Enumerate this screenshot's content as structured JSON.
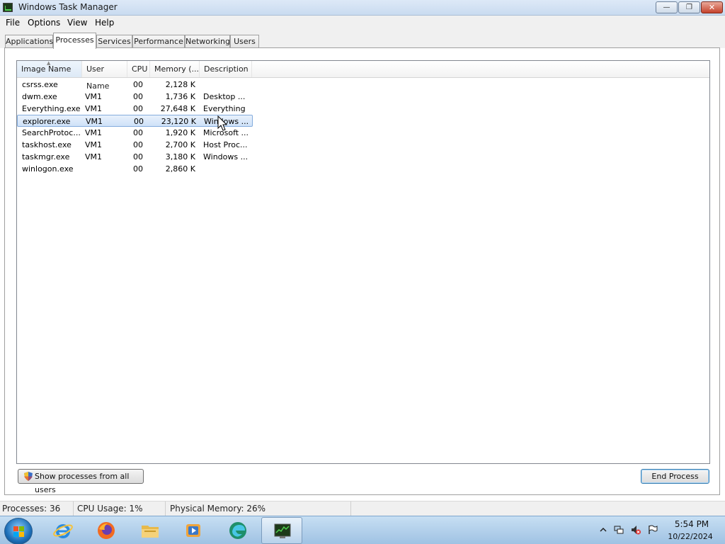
{
  "window": {
    "title": "Windows Task Manager"
  },
  "menu": [
    {
      "label": "File"
    },
    {
      "label": "Options"
    },
    {
      "label": "View"
    },
    {
      "label": "Help"
    }
  ],
  "tabs": [
    {
      "label": "Applications"
    },
    {
      "label": "Processes"
    },
    {
      "label": "Services"
    },
    {
      "label": "Performance"
    },
    {
      "label": "Networking"
    },
    {
      "label": "Users"
    }
  ],
  "active_tab": "Processes",
  "columns": [
    "Image Name",
    "User Name",
    "CPU",
    "Memory (...",
    "Description"
  ],
  "processes": [
    {
      "name": "csrss.exe",
      "user": "",
      "cpu": "00",
      "memory": "2,128 K",
      "description": ""
    },
    {
      "name": "dwm.exe",
      "user": "VM1",
      "cpu": "00",
      "memory": "1,736 K",
      "description": "Desktop ..."
    },
    {
      "name": "Everything.exe",
      "user": "VM1",
      "cpu": "00",
      "memory": "27,648 K",
      "description": "Everything"
    },
    {
      "name": "explorer.exe",
      "user": "VM1",
      "cpu": "00",
      "memory": "23,120 K",
      "description": "Windows ..."
    },
    {
      "name": "SearchProtoc...",
      "user": "VM1",
      "cpu": "00",
      "memory": "1,920 K",
      "description": "Microsoft ..."
    },
    {
      "name": "taskhost.exe",
      "user": "VM1",
      "cpu": "00",
      "memory": "2,700 K",
      "description": "Host Proc..."
    },
    {
      "name": "taskmgr.exe",
      "user": "VM1",
      "cpu": "00",
      "memory": "3,180 K",
      "description": "Windows ..."
    },
    {
      "name": "winlogon.exe",
      "user": "",
      "cpu": "00",
      "memory": "2,860 K",
      "description": ""
    }
  ],
  "selected_process": "explorer.exe",
  "buttons": {
    "show_all": "Show processes from all users",
    "end_process": "End Process"
  },
  "status": {
    "processes": "Processes: 36",
    "cpu": "CPU Usage: 1%",
    "memory": "Physical Memory: 26%"
  },
  "taskbar": {
    "apps": [
      "ie-icon",
      "firefox-icon",
      "explorer-folder-icon",
      "media-player-icon",
      "edge-icon",
      "task-manager-icon"
    ],
    "active_app": "task-manager-icon",
    "tray_icons": [
      "show-hidden-icons",
      "network-icon",
      "volume-muted-icon",
      "action-center-flag-icon"
    ],
    "time": "5:54 PM",
    "date": "10/22/2024"
  },
  "colors": {
    "selection_fill": "#cfe2f8",
    "selection_border": "#84acdd",
    "taskbar": "#b4d1ec"
  }
}
